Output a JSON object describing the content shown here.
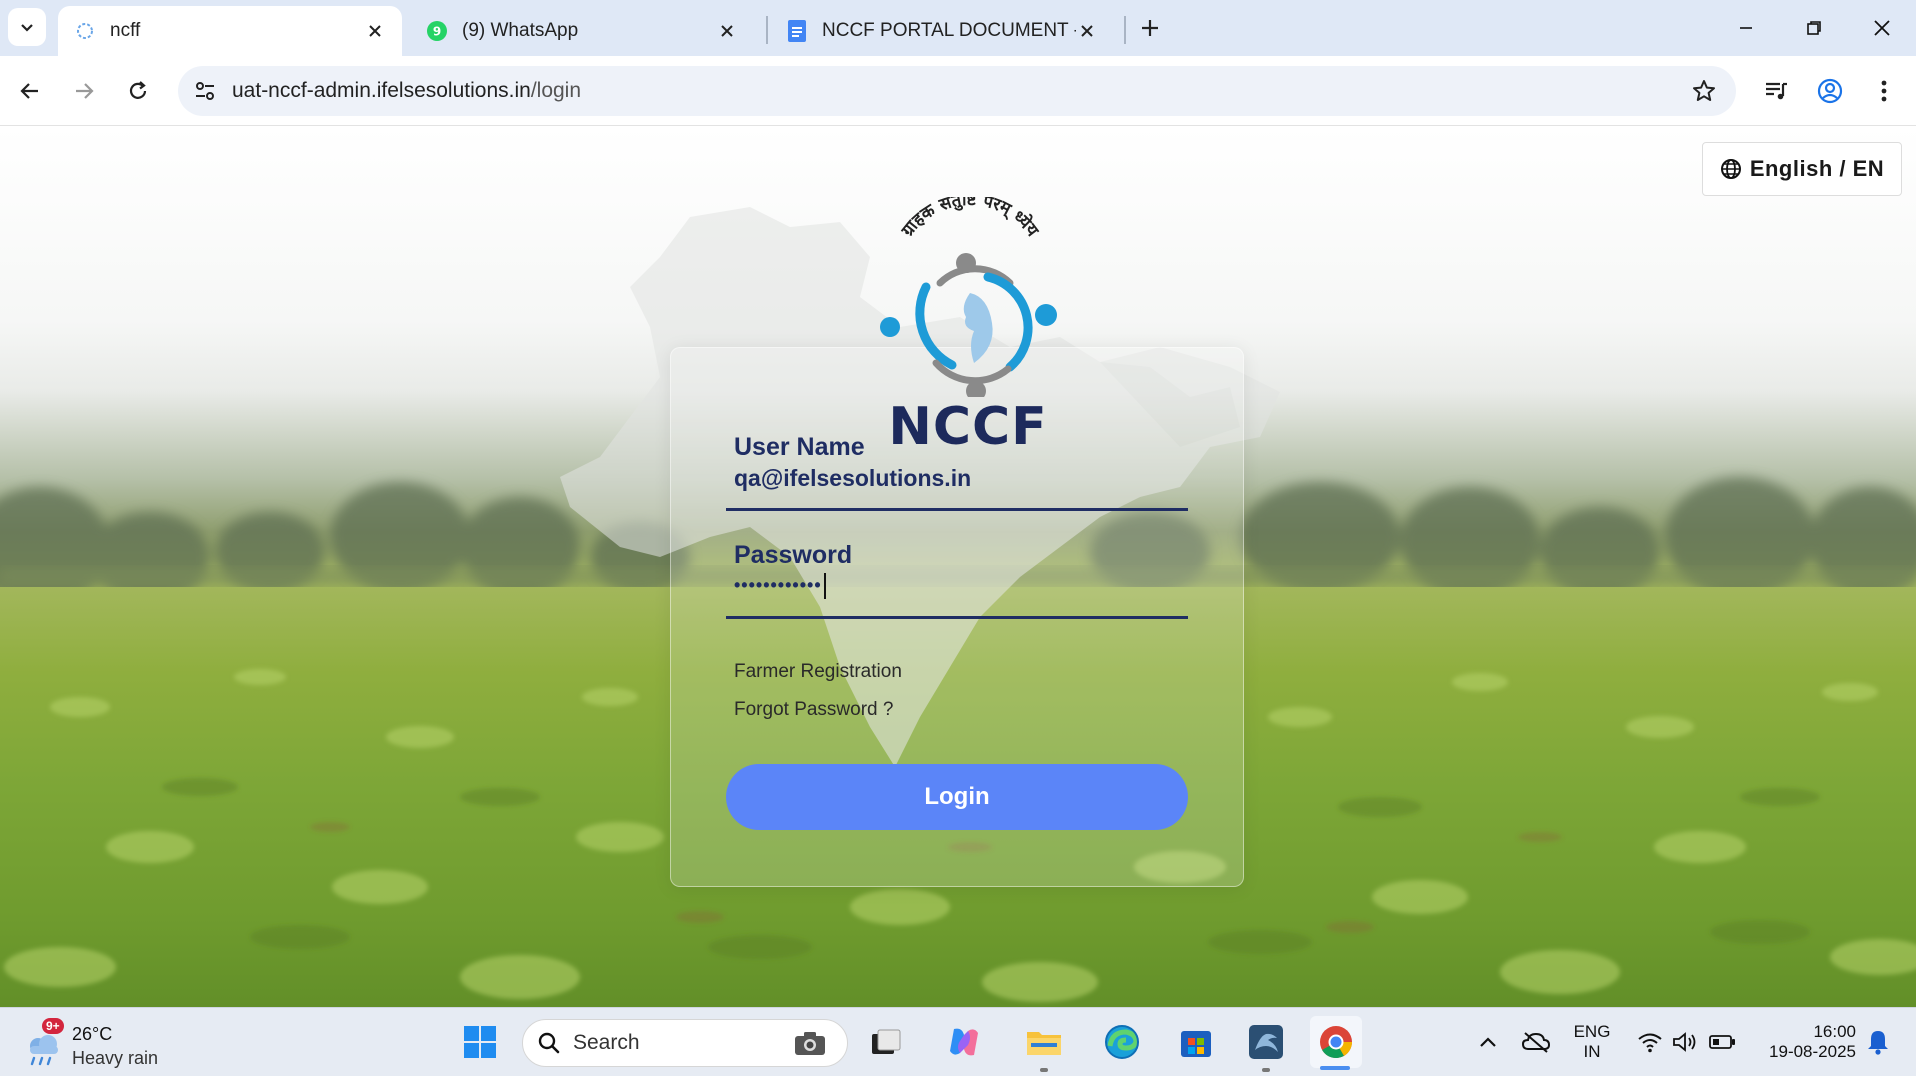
{
  "browser": {
    "tabs": [
      {
        "title": "ncff",
        "active": true
      },
      {
        "title": "(9) WhatsApp",
        "active": false
      },
      {
        "title": "NCCF PORTAL DOCUMENT - Go",
        "active": false
      }
    ],
    "url": {
      "host": "uat-nccf-admin.ifelsesolutions.in",
      "path": "/login"
    }
  },
  "page": {
    "language_label": "English / EN",
    "logo": {
      "tagline": "ग्राहक संतुष्टि परम् ध्येय",
      "name": "NCCF"
    },
    "form": {
      "username_label": "User Name",
      "username_value": "qa@ifelsesolutions.in",
      "password_label": "Password",
      "password_value": "••••••••••••",
      "farmer_registration": "Farmer Registration",
      "forgot_password": "Forgot Password ?",
      "login_label": "Login"
    }
  },
  "taskbar": {
    "weather_badge": "9+",
    "temperature": "26°C",
    "weather": "Heavy rain",
    "search_label": "Search",
    "lang_line1": "ENG",
    "lang_line2": "IN",
    "time": "16:00",
    "date": "19-08-2025"
  },
  "colors": {
    "accent": "#5b85f8",
    "brand_navy": "#1f2d63",
    "logo_blue": "#1e9bd7"
  }
}
